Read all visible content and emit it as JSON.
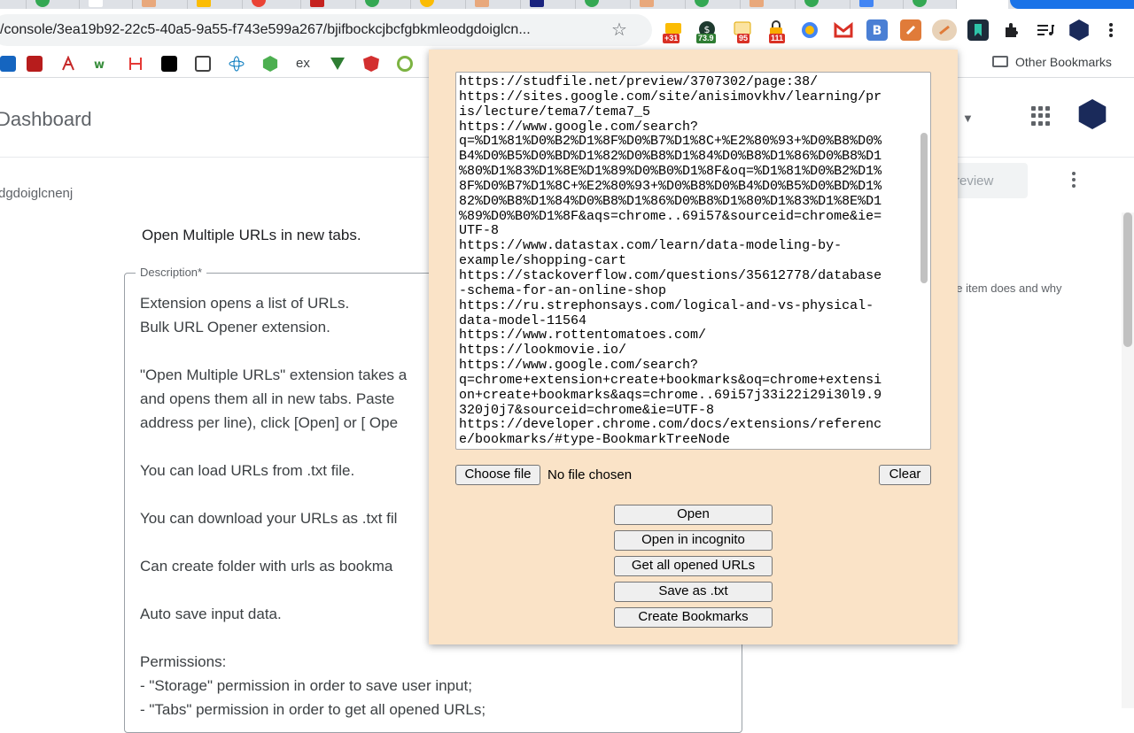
{
  "browser": {
    "omnibox_url": "/console/3ea19b92-22c5-40a5-9a55-f743e599a267/bjifbockcjbcfgbkmleodgdoiglcn...",
    "extension_badges": [
      "+31",
      "73.9",
      "95",
      "111"
    ],
    "other_bookmarks": "Other Bookmarks",
    "bookmark_text_ex": "ex"
  },
  "page": {
    "title": "Dashboard",
    "header_dropdown": "q",
    "extension_id_partial": "dgdoiglcnenj",
    "preview_button": "review",
    "item_name": "Open Multiple URLs in new tabs.",
    "description_legend": "Description*",
    "side_hint": "ne item does and why",
    "description_lines": [
      "Extension opens a list of URLs.",
      "Bulk URL Opener extension.",
      "",
      "\"Open Multiple URLs\" extension takes a",
      "and opens them all in new tabs. Paste",
      "address per line), click [Open] or [ Ope",
      "",
      "You can load URLs from .txt file.",
      "",
      "You can download your URLs as .txt fil",
      "",
      "Can create folder with urls as bookma",
      "",
      "Auto save input data.",
      "",
      "Permissions:",
      "- \"Storage\" permission in order to save user input;",
      "- \"Tabs\" permission in order to get all opened URLs;"
    ]
  },
  "popup": {
    "url_lines": [
      "https://studfile.net/preview/3707302/page:38/",
      "https://sites.google.com/site/anisimovkhv/learning/pr",
      "is/lecture/tema7/tema7_5",
      "https://www.google.com/search?",
      "q=%D1%81%D0%B2%D1%8F%D0%B7%D1%8C+%E2%80%93+%D0%B8%D0%",
      "B4%D0%B5%D0%BD%D1%82%D0%B8%D1%84%D0%B8%D1%86%D0%B8%D1",
      "%80%D1%83%D1%8E%D1%89%D0%B0%D1%8F&oq=%D1%81%D0%B2%D1%",
      "8F%D0%B7%D1%8C+%E2%80%93+%D0%B8%D0%B4%D0%B5%D0%BD%D1%",
      "82%D0%B8%D1%84%D0%B8%D1%86%D0%B8%D1%80%D1%83%D1%8E%D1",
      "%89%D0%B0%D1%8F&aqs=chrome..69i57&sourceid=chrome&ie=",
      "UTF-8",
      "https://www.datastax.com/learn/data-modeling-by-",
      "example/shopping-cart",
      "https://stackoverflow.com/questions/35612778/database",
      "-schema-for-an-online-shop",
      "https://ru.strephonsays.com/logical-and-vs-physical-",
      "data-model-11564",
      "https://www.rottentomatoes.com/",
      "https://lookmovie.io/",
      "https://www.google.com/search?",
      "q=chrome+extension+create+bookmarks&oq=chrome+extensi",
      "on+create+bookmarks&aqs=chrome..69i57j33i22i29i30l9.9",
      "320j0j7&sourceid=chrome&ie=UTF-8",
      "https://developer.chrome.com/docs/extensions/referenc",
      "e/bookmarks/#type-BookmarkTreeNode"
    ],
    "choose_file": "Choose file",
    "no_file": "No file chosen",
    "clear": "Clear",
    "open": "Open",
    "open_incognito": "Open in incognito",
    "get_all": "Get all opened URLs",
    "save_txt": "Save as .txt",
    "create_bookmarks": "Create Bookmarks"
  }
}
